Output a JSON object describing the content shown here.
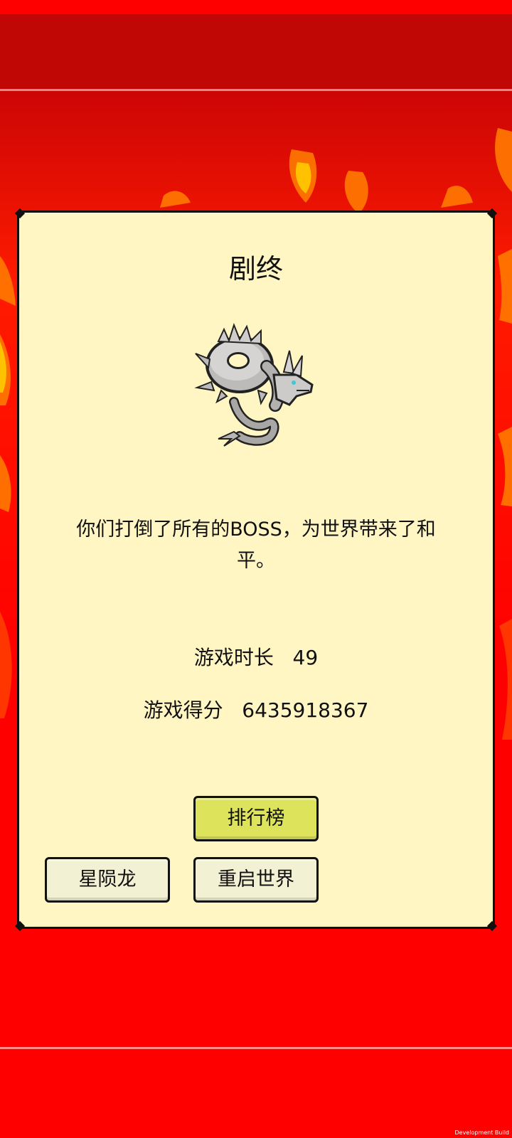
{
  "dialog": {
    "title": "剧终",
    "boss_image": "silver-dragon-pixel-art",
    "message": "你们打倒了所有的BOSS，为世界带来了和平。",
    "stats": {
      "time_label": "游戏时长",
      "time_value": "49",
      "score_label": "游戏得分",
      "score_value": "6435918367"
    },
    "buttons": {
      "leaderboard": "排行榜",
      "dragon": "星陨龙",
      "restart": "重启世界"
    }
  },
  "footer": {
    "build_label": "Development Build"
  },
  "colors": {
    "background": "#ff0000",
    "top_band": "#c10606",
    "dialog_bg": "#fff6c3",
    "primary_button": "#dde35a",
    "secondary_button": "#f3f1d3"
  }
}
